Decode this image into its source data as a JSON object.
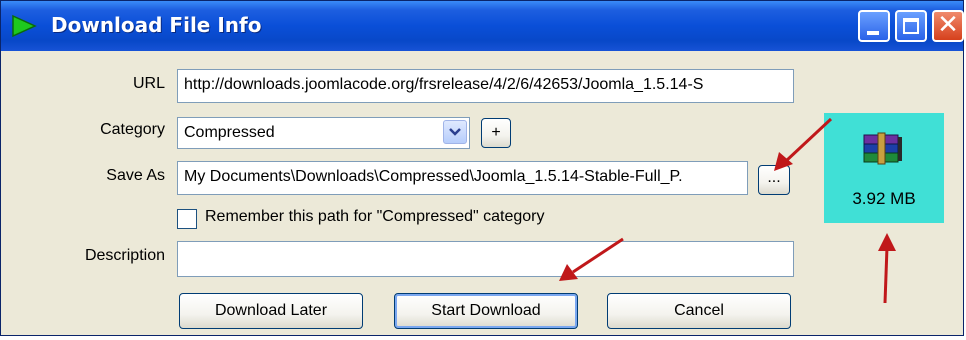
{
  "window": {
    "title": "Download File Info",
    "accent_color": "#0a4fd8",
    "controls": {
      "minimize": "minimize-icon",
      "maximize": "maximize-icon",
      "close": "close-icon"
    }
  },
  "form": {
    "url": {
      "label": "URL",
      "value": "http://downloads.joomlacode.org/frsrelease/4/2/6/42653/Joomla_1.5.14-S"
    },
    "category": {
      "label": "Category",
      "value": "Compressed",
      "add_label": "+"
    },
    "save_as": {
      "label": "Save As",
      "value": "My Documents\\Downloads\\Compressed\\Joomla_1.5.14-Stable-Full_P.",
      "browse_label": "..."
    },
    "remember": {
      "label": "Remember this path for \"Compressed\" category",
      "checked": false
    },
    "description": {
      "label": "Description",
      "value": ""
    }
  },
  "buttons": {
    "download_later": "Download Later",
    "start_download": "Start Download",
    "cancel": "Cancel"
  },
  "file": {
    "icon": "winrar-archive-icon",
    "size": "3.92  MB",
    "highlight_color": "#40e0d6"
  },
  "annotations": {
    "arrow_color": "#c0181a"
  }
}
